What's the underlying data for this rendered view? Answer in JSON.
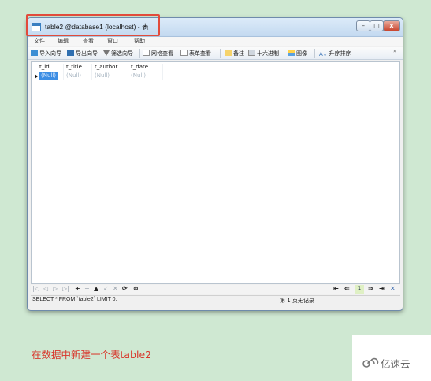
{
  "window": {
    "title": "table2 @database1 (localhost) - 表",
    "controls": {
      "minimize": "–",
      "maximize": "□",
      "close": "x"
    }
  },
  "menu": [
    "文件",
    "编辑",
    "查看",
    "窗口",
    "帮助"
  ],
  "toolbar": {
    "import_wizard": "导入向导",
    "export_wizard": "导出向导",
    "filter_wizard": "筛选向导",
    "grid_view": "网格查看",
    "form_view": "表单查看",
    "memo": "备注",
    "hex": "十六进制",
    "image": "图像",
    "sort_asc": "升序排序",
    "more": "»",
    "sort_icon_text": "A↓"
  },
  "table": {
    "columns": [
      "t_id",
      "t_title",
      "t_author",
      "t_date"
    ],
    "row": [
      "(Null)",
      "(Null)",
      "(Null)",
      "(Null)"
    ]
  },
  "navigation": {
    "first": "|◁",
    "prev": "◁",
    "next": "▷",
    "last": "▷|",
    "add": "+",
    "delete": "−",
    "up": "▲",
    "apply": "✓",
    "cancel": "✕",
    "refresh": "⟳",
    "stop": "⊗",
    "page_first": "⇤",
    "page_prev": "⇐",
    "page_current": "1",
    "page_next": "⇒",
    "page_last": "⇥",
    "page_close": "✕"
  },
  "status": {
    "sql": "SELECT * FROM `table2` LIMIT 0,",
    "records": "第 1 页无记录"
  },
  "caption": "在数据中新建一个表table2",
  "watermark": "亿速云",
  "colors": {
    "highlight_border": "#e24b3b",
    "caption": "#d8372c",
    "background": "#cfe8d2"
  }
}
